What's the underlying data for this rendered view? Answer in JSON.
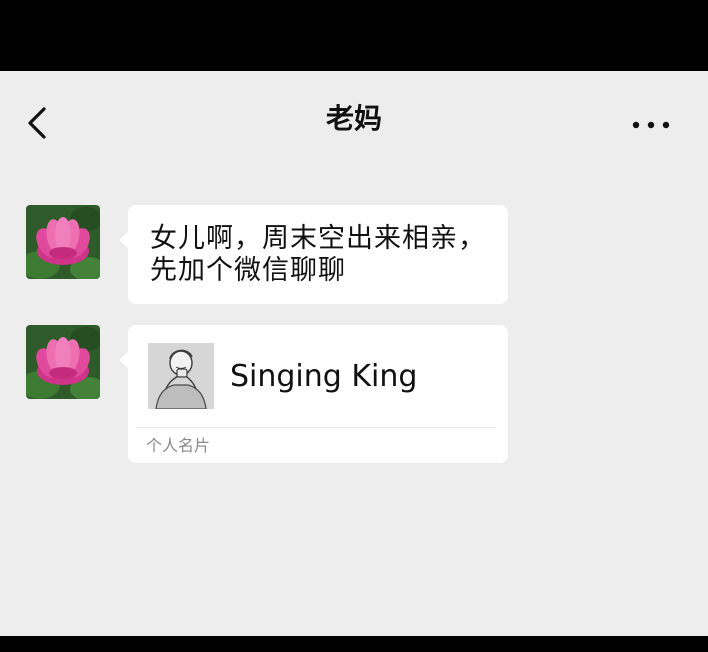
{
  "header": {
    "title": "老妈",
    "back_icon": "chevron-left-icon",
    "more_icon": "more-horizontal-icon"
  },
  "messages": [
    {
      "type": "text",
      "avatar_icon": "lotus-flower-avatar",
      "text": "女儿啊，周末空出来相亲，先加个微信聊聊"
    },
    {
      "type": "contact_card",
      "avatar_icon": "lotus-flower-avatar",
      "card_thumb_icon": "person-sketch-icon",
      "card_name": "Singing King",
      "card_label": "个人名片"
    }
  ],
  "colors": {
    "background": "#ededed",
    "bubble": "#ffffff",
    "letterbox": "#000000",
    "text": "#111111",
    "muted_text": "#8a8a8a"
  }
}
